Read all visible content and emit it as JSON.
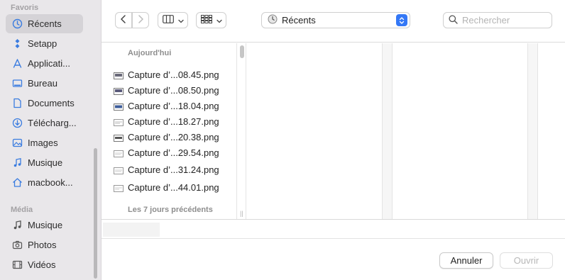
{
  "sidebar": {
    "sections": [
      {
        "title": "Favoris"
      },
      {
        "title": "Média"
      }
    ],
    "favorites": [
      {
        "label": "Récents",
        "icon": "clock-icon",
        "selected": true
      },
      {
        "label": "Setapp",
        "icon": "setapp-icon"
      },
      {
        "label": "Applicati...",
        "icon": "applications-icon"
      },
      {
        "label": "Bureau",
        "icon": "desktop-icon"
      },
      {
        "label": "Documents",
        "icon": "document-icon"
      },
      {
        "label": "Télécharg...",
        "icon": "download-icon"
      },
      {
        "label": "Images",
        "icon": "photo-icon"
      },
      {
        "label": "Musique",
        "icon": "music-note-icon"
      },
      {
        "label": "macbook...",
        "icon": "home-icon"
      }
    ],
    "media": [
      {
        "label": "Musique",
        "icon": "music-note-icon"
      },
      {
        "label": "Photos",
        "icon": "camera-icon"
      },
      {
        "label": "Vidéos",
        "icon": "film-icon"
      }
    ]
  },
  "toolbar": {
    "location": "Récents",
    "search_placeholder": "Rechercher"
  },
  "browser": {
    "group_today": "Aujourd'hui",
    "group_week": "Les 7 jours précédents",
    "files": [
      {
        "name": "Capture d’...08.45.png"
      },
      {
        "name": "Capture d’...08.50.png"
      },
      {
        "name": "Capture d’...18.04.png"
      },
      {
        "name": "Capture d’...18.27.png"
      },
      {
        "name": "Capture d’...20.38.png"
      },
      {
        "name": "Capture d’...29.54.png"
      },
      {
        "name": "Capture d’...31.24.png"
      },
      {
        "name": "Capture d’...44.01.png"
      }
    ]
  },
  "buttons": {
    "cancel": "Annuler",
    "open": "Ouvrir"
  },
  "colors": {
    "sidebar_bg": "#e9e7ea",
    "selection": "#d5d3d7",
    "accent": "#3478f6",
    "icon_blue": "#3a7ce0"
  }
}
